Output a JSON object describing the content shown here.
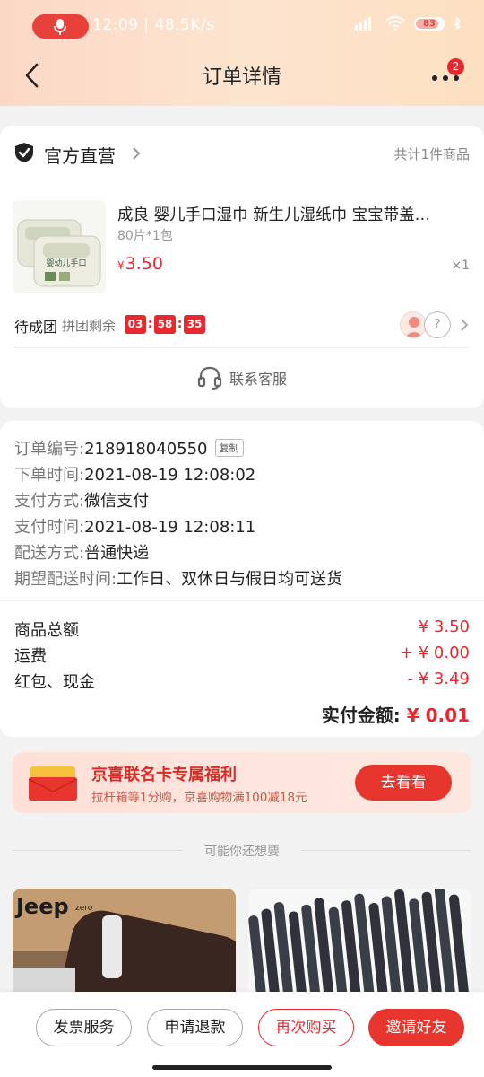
{
  "status_bar": {
    "text": "12:09 | 48.5K/s",
    "battery": "83",
    "battery_level": 0.83
  },
  "nav": {
    "title": "订单详情",
    "badge": "2"
  },
  "store": {
    "name": "官方直营",
    "item_count": "共计1件商品",
    "icon": "shield-check-icon"
  },
  "product": {
    "title": "成良 婴儿手口湿巾 新生儿湿纸巾 宝宝带盖…",
    "spec": "80片*1包",
    "currency": "¥",
    "price": "3.50",
    "qty": "×1",
    "image_text": "婴幼儿手口"
  },
  "group": {
    "status": "待成团",
    "remain_label": "拼团剩余",
    "hours": "03",
    "minutes": "58",
    "seconds": "35",
    "unknown_avatar": "?"
  },
  "service": {
    "label": "联系客服",
    "icon": "headset-icon"
  },
  "order_info": {
    "order_no_label": "订单编号:",
    "order_no": "218918040550",
    "copy_label": "复制",
    "order_time_label": "下单时间:",
    "order_time": "2021-08-19 12:08:02",
    "pay_method_label": "支付方式:",
    "pay_method": "微信支付",
    "pay_time_label": "支付时间:",
    "pay_time": "2021-08-19 12:08:11",
    "delivery_label": "配送方式:",
    "delivery": "普通快递",
    "expected_label": "期望配送时间:",
    "expected": "工作日、双休日与假日均可送货"
  },
  "fees": {
    "total_label": "商品总额",
    "total": "¥ 3.50",
    "shipping_label": "运费",
    "shipping": "+ ¥ 0.00",
    "discount_label": "红包、现金",
    "discount": "- ¥ 3.49",
    "paid_label": "实付金额:",
    "paid": "¥ 0.01"
  },
  "promo": {
    "title": "京喜联名卡专属福利",
    "subtitle": "拉杆箱等1分购，京喜购物满100减18元",
    "button": "去看看"
  },
  "recommend": {
    "title": "可能你还想要",
    "brand_text": "Jeep",
    "brand_sub": "zero"
  },
  "bottom_bar": {
    "invoice": "发票服务",
    "refund": "申请退款",
    "rebuy": "再次购买",
    "invite": "邀请好友"
  },
  "colors": {
    "accent": "#e8272e",
    "header_bg": "#fde4cf",
    "promo_bg": "#fee0d8"
  }
}
